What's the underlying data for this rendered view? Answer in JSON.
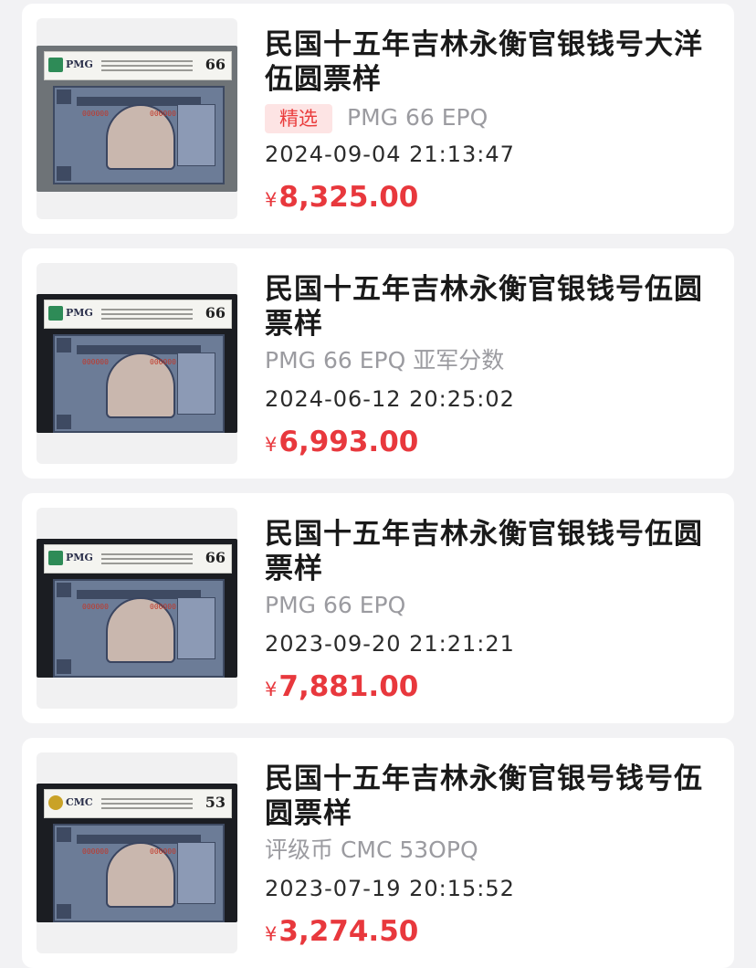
{
  "listings": [
    {
      "title": "民国十五年吉林永衡官银钱号大洋伍圆票样",
      "badge": "精选",
      "grade_text": "PMG 66 EPQ",
      "date": "2024-09-04 21:13:47",
      "currency": "¥",
      "price": "8,325.00",
      "image": {
        "grader": "PMG",
        "grade": "66",
        "slab_color": "gray"
      }
    },
    {
      "title": "民国十五年吉林永衡官银钱号伍圆票样",
      "grade_text": "PMG 66 EPQ 亚军分数",
      "date": "2024-06-12 20:25:02",
      "currency": "¥",
      "price": "6,993.00",
      "image": {
        "grader": "PMG",
        "grade": "66",
        "slab_color": "dark"
      }
    },
    {
      "title": "民国十五年吉林永衡官银钱号伍圆票样",
      "grade_text": "PMG 66 EPQ",
      "date": "2023-09-20 21:21:21",
      "currency": "¥",
      "price": "7,881.00",
      "image": {
        "grader": "PMG",
        "grade": "66",
        "slab_color": "dark"
      }
    },
    {
      "title": "民国十五年吉林永衡官银号钱号伍圆票样",
      "grade_text": "评级币 CMC 53OPQ",
      "date": "2023-07-19 20:15:52",
      "currency": "¥",
      "price": "3,274.50",
      "image": {
        "grader": "CMC",
        "grade": "53",
        "slab_color": "dark"
      }
    }
  ],
  "colors": {
    "price": "#e8383d",
    "badge_bg": "#fde4e4",
    "badge_text": "#ea3c3c",
    "muted": "#9b9ba0"
  }
}
